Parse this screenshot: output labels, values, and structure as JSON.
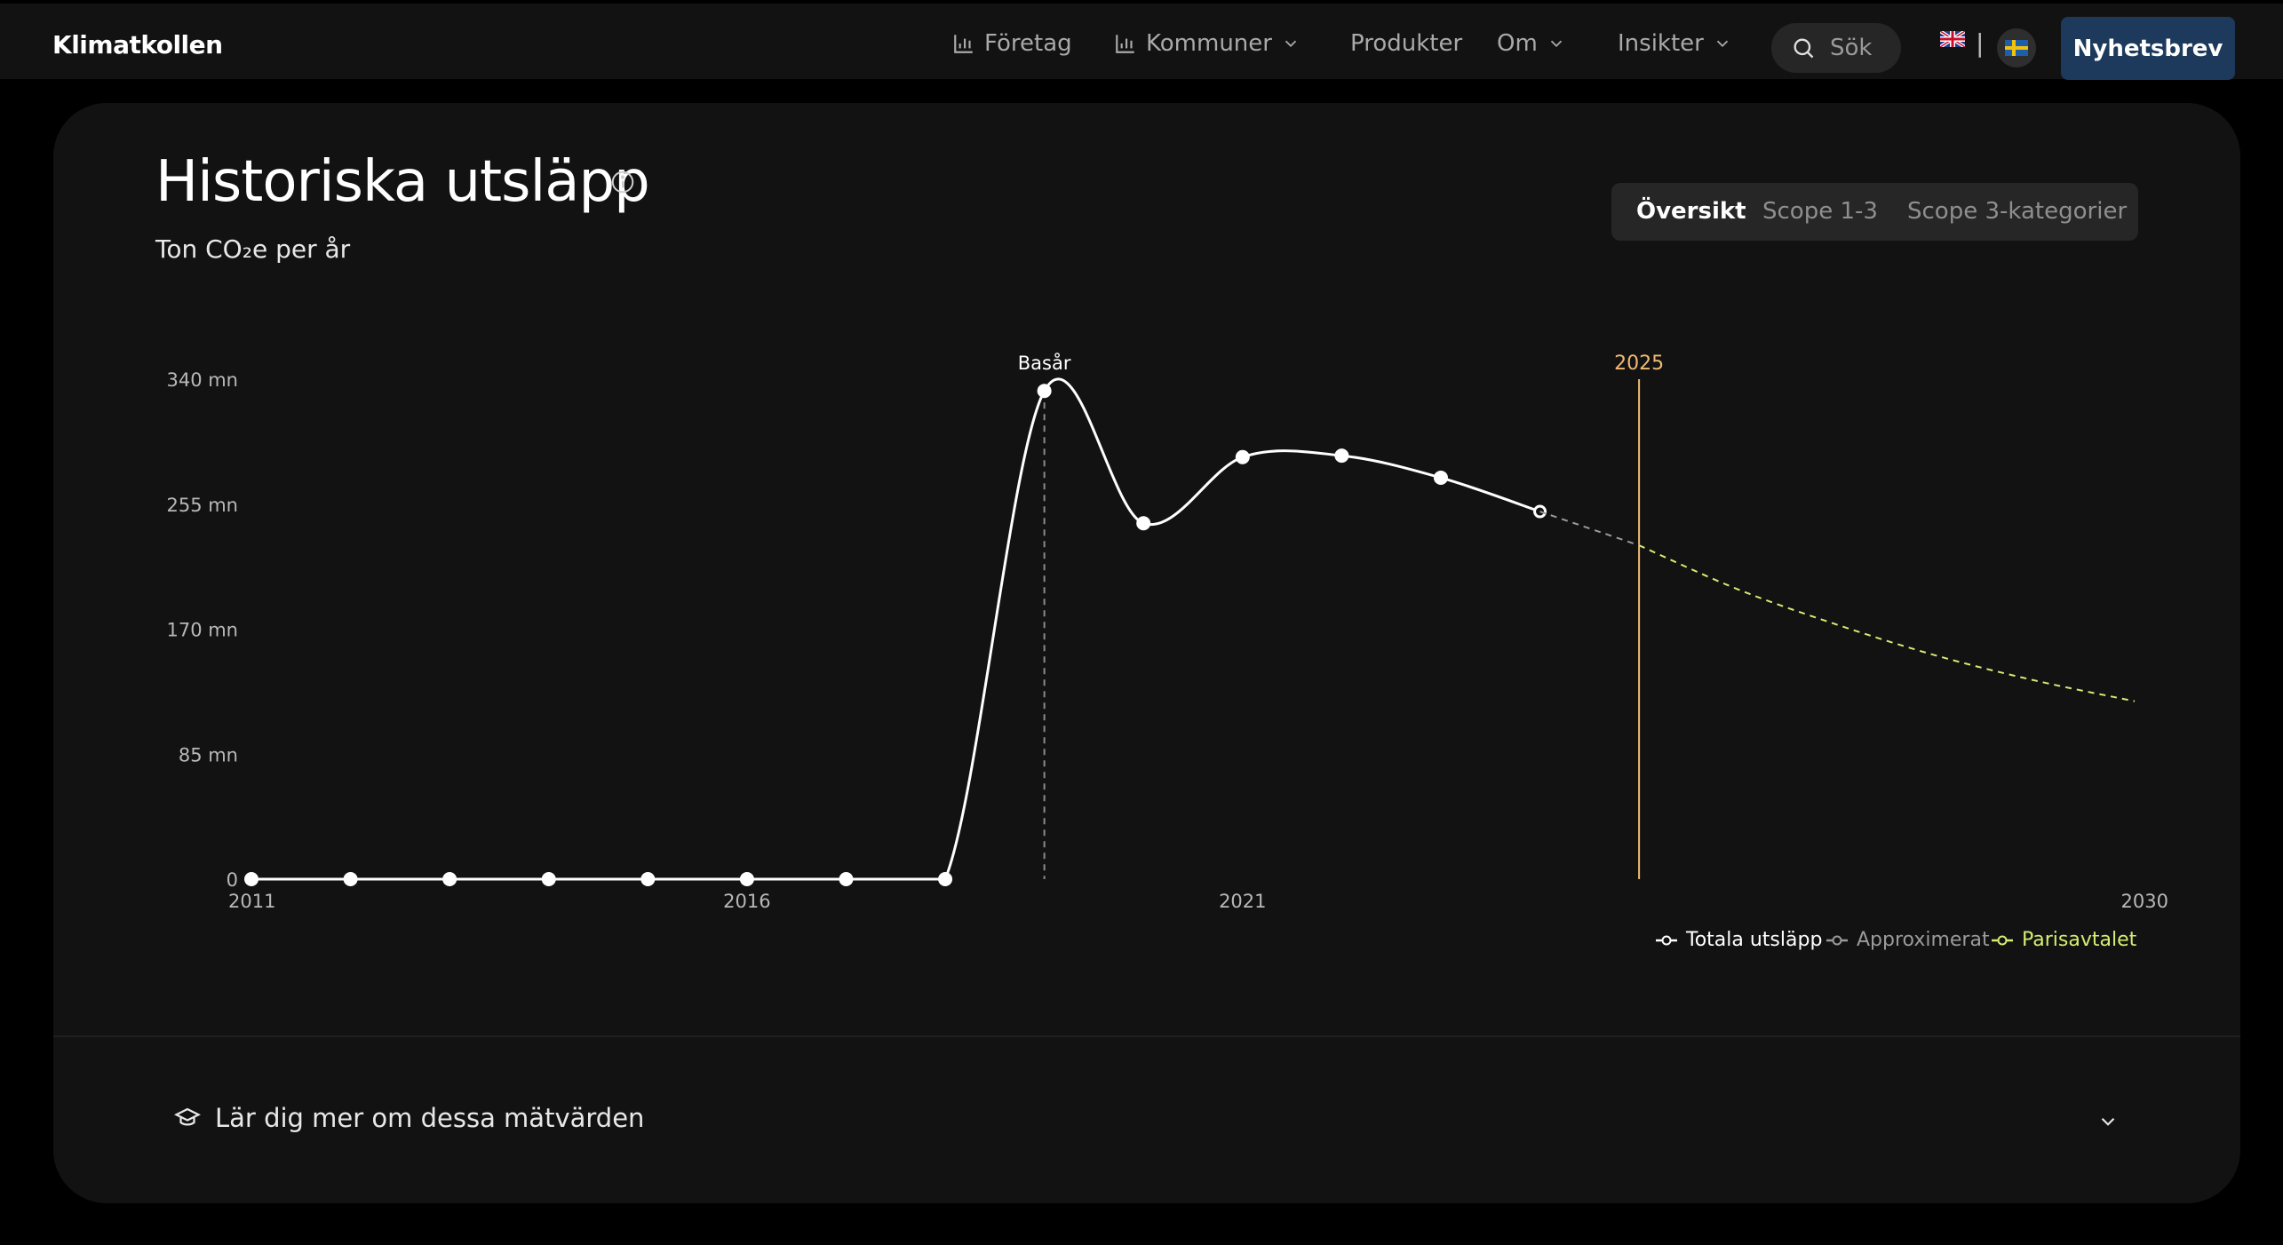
{
  "nav": {
    "brand": "Klimatkollen",
    "items": [
      "Företag",
      "Kommuner",
      "Produkter",
      "Om",
      "Insikter"
    ],
    "search_placeholder": "Sök",
    "lang_separator": "|",
    "newsletter": "Nyhetsbrev"
  },
  "section": {
    "title": "Historiska utsläpp",
    "subtitle": "Ton CO₂e per år",
    "tabs": [
      "Översikt",
      "Scope 1-3",
      "Scope 3-kategorier"
    ],
    "active_tab": "Översikt",
    "learn_more": "Lär dig mer om dessa mätvärden"
  },
  "chart_data": {
    "type": "line",
    "xlim": [
      2011,
      2030
    ],
    "ylim": [
      0,
      340
    ],
    "y_ticks": [
      0,
      85,
      170,
      255,
      340
    ],
    "y_tick_labels": [
      "0",
      "85 mn",
      "170 mn",
      "255 mn",
      "340 mn"
    ],
    "x_ticks": [
      2011,
      2016,
      2021,
      2030
    ],
    "x_tick_labels": [
      "2011",
      "2016",
      "2021",
      "2030"
    ],
    "base_year": 2019,
    "base_year_label": "Basår",
    "current_year": 2025,
    "current_year_label": "2025",
    "series": [
      {
        "name": "Totala utsläpp",
        "color": "#ffffff",
        "style": "solid",
        "x": [
          2011,
          2012,
          2013,
          2014,
          2015,
          2016,
          2017,
          2018,
          2019,
          2020,
          2021,
          2022,
          2023,
          2024
        ],
        "y": [
          0,
          0,
          0,
          0,
          0,
          0,
          0,
          0,
          332,
          242,
          287,
          288,
          273,
          250
        ]
      },
      {
        "name": "Approximerat",
        "color": "#9a9a9a",
        "style": "dashed",
        "x": [
          2024,
          2025
        ],
        "y": [
          250,
          227
        ]
      },
      {
        "name": "Parisavtalet",
        "color": "#d4ee72",
        "style": "dashed",
        "x": [
          2025,
          2026,
          2027,
          2028,
          2029,
          2030
        ],
        "y": [
          227,
          197,
          173,
          152,
          135,
          121
        ]
      }
    ],
    "legend": [
      "Totala utsläpp",
      "Approximerat",
      "Parisavtalet"
    ],
    "legend_position": "bottom-right",
    "grid": false
  }
}
